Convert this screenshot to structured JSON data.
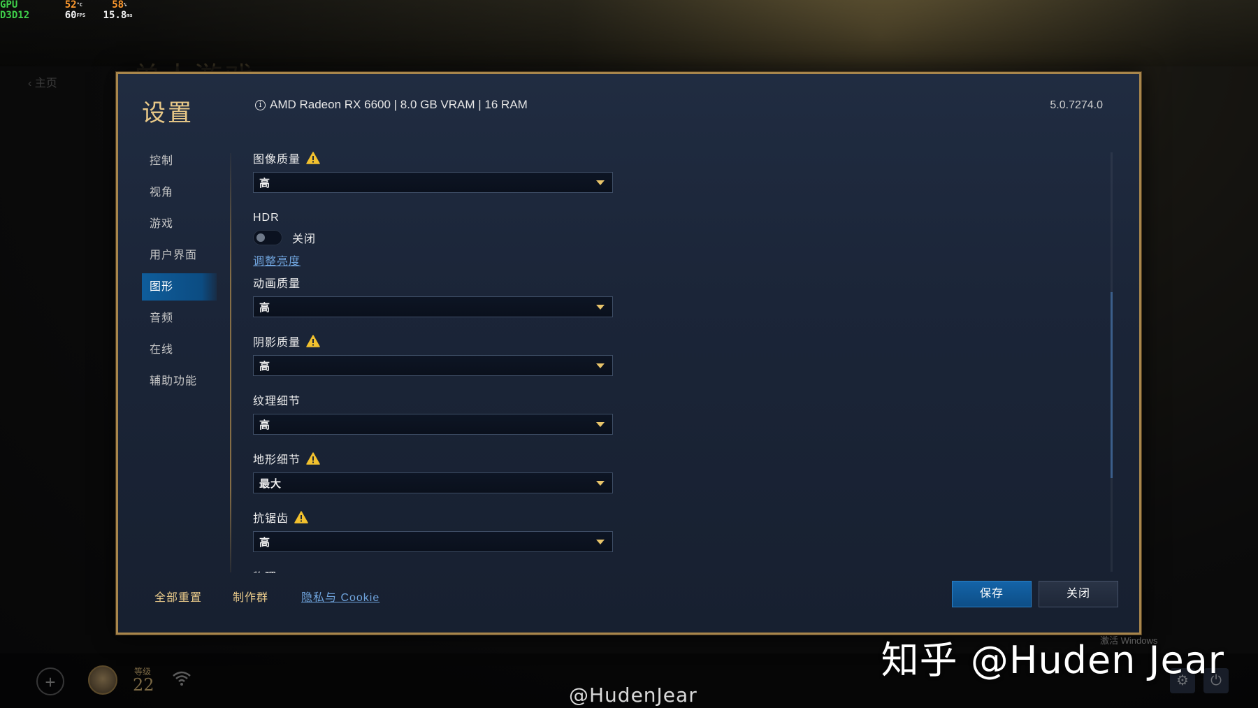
{
  "overlay": {
    "gpu_label": "GPU",
    "api_label": "D3D12",
    "gpu_temp": "52",
    "gpu_temp_unit": "°C",
    "gpu_load": "58",
    "gpu_load_unit": "%",
    "fps": "60",
    "fps_unit": "FPS",
    "frametime": "15.8",
    "frametime_unit": "ms"
  },
  "background": {
    "ghost_title": "单人游戏",
    "ghost_back": "‹ 主页"
  },
  "panel": {
    "title": "设置",
    "gpu_info": "AMD Radeon RX 6600 | 8.0 GB VRAM | 16 RAM",
    "version": "5.0.7274.0",
    "border_color": "#a8864c",
    "accent_color": "#0f5d9b"
  },
  "nav": {
    "items": [
      {
        "label": "控制"
      },
      {
        "label": "视角"
      },
      {
        "label": "游戏"
      },
      {
        "label": "用户界面"
      },
      {
        "label": "图形",
        "active": true
      },
      {
        "label": "音频"
      },
      {
        "label": "在线"
      },
      {
        "label": "辅助功能"
      }
    ]
  },
  "settings": {
    "image_quality": {
      "label": "图像质量",
      "value": "高",
      "warning": true
    },
    "hdr": {
      "label": "HDR",
      "state": "关闭",
      "link": "调整亮度"
    },
    "animation_quality": {
      "label": "动画质量",
      "value": "高",
      "warning": false
    },
    "shadow_quality": {
      "label": "阴影质量",
      "value": "高",
      "warning": true
    },
    "texture_detail": {
      "label": "纹理细节",
      "value": "高",
      "warning": false
    },
    "terrain_detail": {
      "label": "地形细节",
      "value": "最大",
      "warning": true
    },
    "antialiasing": {
      "label": "抗锯齿",
      "value": "高",
      "warning": true
    },
    "physics_partial": {
      "label": "物理"
    }
  },
  "footer": {
    "reset_all": "全部重置",
    "credits": "制作群",
    "privacy": "隐私与 Cookie",
    "save": "保存",
    "close": "关闭"
  },
  "bottom_bar": {
    "level_label": "等级",
    "level": "22"
  },
  "watermarks": {
    "big": "知乎 @Huden Jear",
    "small": "@HudenJear",
    "activate": "激活 Windows"
  },
  "icons": [
    "info-icon",
    "warning-icon",
    "chevron-down-icon",
    "plus-icon",
    "wifi-icon",
    "gear-icon",
    "power-icon"
  ]
}
